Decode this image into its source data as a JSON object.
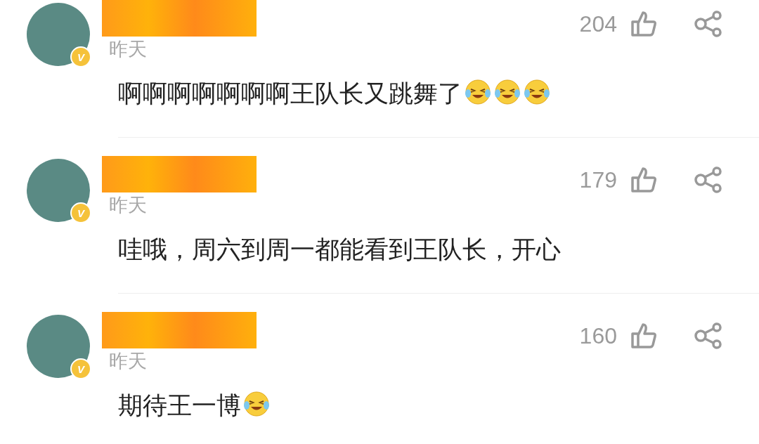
{
  "comments": [
    {
      "badge": "V",
      "time": "昨天",
      "likes": "204",
      "body": [
        {
          "kind": "text",
          "text": "啊啊啊啊啊啊啊王队长又跳舞了"
        },
        {
          "kind": "emoji"
        },
        {
          "kind": "emoji"
        },
        {
          "kind": "emoji"
        }
      ]
    },
    {
      "badge": "V",
      "time": "昨天",
      "likes": "179",
      "body": [
        {
          "kind": "text",
          "text": "哇哦，周六到周一都能看到王队长，开心"
        }
      ]
    },
    {
      "badge": "V",
      "time": "昨天",
      "likes": "160",
      "body": [
        {
          "kind": "text",
          "text": "期待王一博"
        },
        {
          "kind": "emoji"
        }
      ]
    }
  ]
}
